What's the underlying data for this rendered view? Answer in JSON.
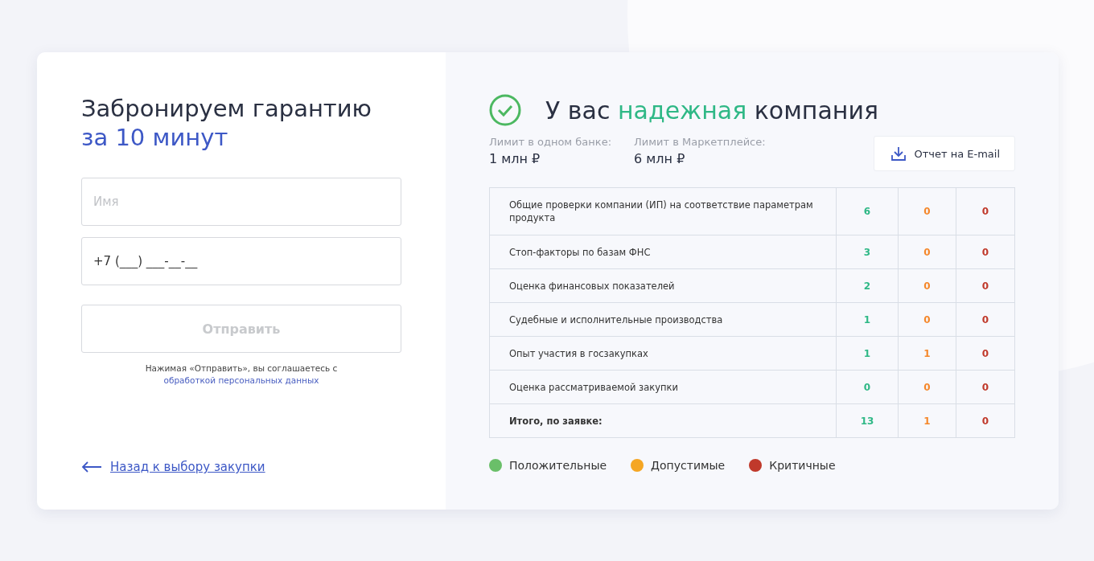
{
  "form": {
    "title": [
      {
        "text": "Забронируем гарантию",
        "accent": false
      },
      {
        "text": "за 10 минут",
        "accent": true
      }
    ],
    "fields": [
      {
        "placeholder": "Имя"
      },
      {
        "value": "+7 (___) ___-__-__"
      }
    ],
    "submit": {
      "label": "Отправить",
      "disabled": true
    },
    "consent": {
      "text": "Нажимая «Отправить», вы соглашаетесь с",
      "link": "обработкой персональных данных"
    },
    "back_link": "Назад к выбору закупки"
  },
  "result": {
    "title": [
      {
        "text": "У вас ",
        "accent": false
      },
      {
        "text": "надежная",
        "accent": true
      },
      {
        "text": " компания",
        "accent": false
      }
    ],
    "limits": [
      {
        "label": "Лимит в одном банке:",
        "value": "1 млн ₽"
      },
      {
        "label": "Лимит в Маркетплейсе:",
        "value": "6 млн ₽"
      }
    ],
    "report_button": "Отчет на E-mail",
    "table": {
      "rows": [
        {
          "label": "Общие проверки компании (ИП) на соответствие параметрам продукта",
          "values": [
            "6",
            "0",
            "0"
          ],
          "total": false
        },
        {
          "label": "Стоп-факторы по базам ФНС",
          "values": [
            "3",
            "0",
            "0"
          ],
          "total": false
        },
        {
          "label": "Оценка финансовых показателей",
          "values": [
            "2",
            "0",
            "0"
          ],
          "total": false
        },
        {
          "label": "Судебные и исполнительные производства",
          "values": [
            "1",
            "0",
            "0"
          ],
          "total": false
        },
        {
          "label": "Опыт участия в госзакупках",
          "values": [
            "1",
            "1",
            "0"
          ],
          "total": false
        },
        {
          "label": "Оценка рассматриваемой закупки",
          "values": [
            "0",
            "0",
            "0"
          ],
          "total": false
        },
        {
          "label": "Итого, по заявке:",
          "values": [
            "13",
            "1",
            "0"
          ],
          "total": true
        }
      ]
    },
    "legend": [
      {
        "label": "Положительные",
        "color": "#6abf69"
      },
      {
        "label": "Допустимые",
        "color": "#f5a623"
      },
      {
        "label": "Критичные",
        "color": "#c0392b"
      }
    ]
  }
}
